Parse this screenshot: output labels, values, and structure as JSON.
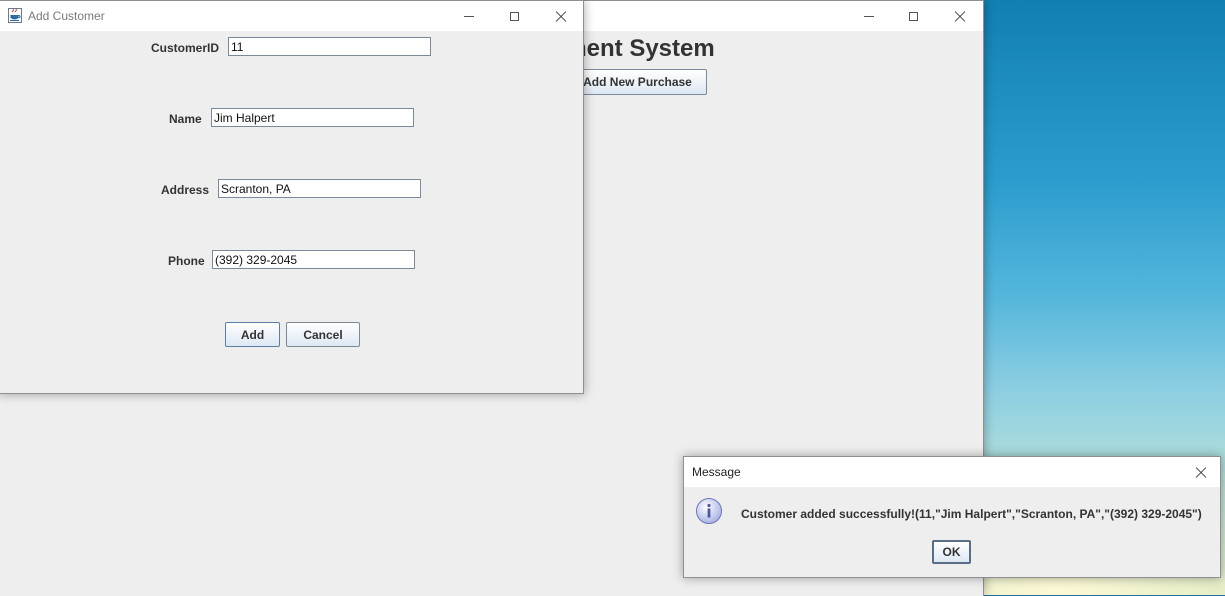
{
  "main_window": {
    "heading": "nent System",
    "add_purchase_label": "Add New Purchase"
  },
  "add_customer": {
    "title": "Add Customer",
    "fields": {
      "customer_id": {
        "label": "CustomerID",
        "value": "11"
      },
      "name": {
        "label": "Name",
        "value": "Jim Halpert"
      },
      "address": {
        "label": "Address",
        "value": "Scranton, PA"
      },
      "phone": {
        "label": "Phone",
        "value": "(392) 329-2045"
      }
    },
    "add_label": "Add",
    "cancel_label": "Cancel"
  },
  "message_dialog": {
    "title": "Message",
    "icon": "info-icon",
    "text": "Customer added successfully!(11,\"Jim Halpert\",\"Scranton, PA\",\"(392) 329-2045\")",
    "ok_label": "OK"
  }
}
